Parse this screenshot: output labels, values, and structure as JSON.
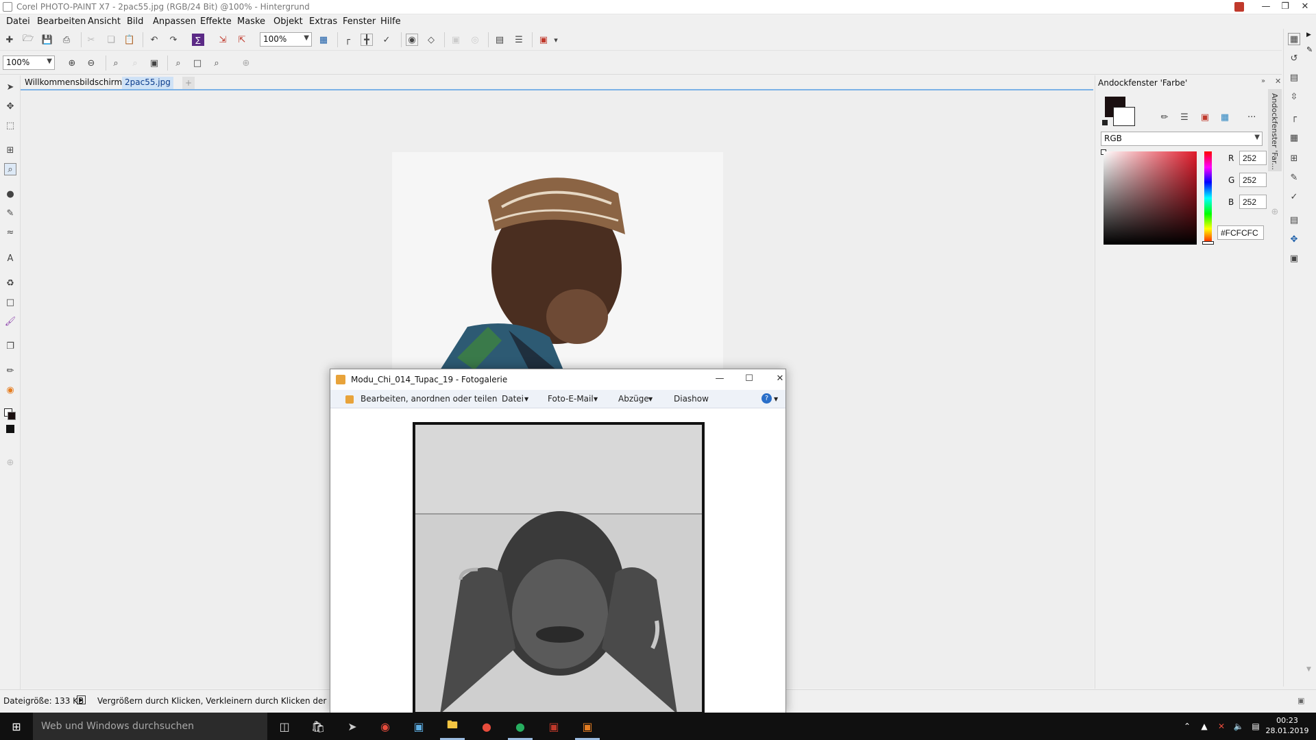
{
  "window": {
    "title": "Corel PHOTO-PAINT X7 - 2pac55.jpg (RGB/24 Bit) @100% - Hintergrund",
    "minimize_icon": "minimize-icon",
    "maximize_icon": "restore-icon",
    "close_icon": "close-icon"
  },
  "menu": [
    "Datei",
    "Bearbeiten",
    "Ansicht",
    "Bild",
    "Anpassen",
    "Effekte",
    "Maske",
    "Objekt",
    "Extras",
    "Fenster",
    "Hilfe"
  ],
  "toolbar": {
    "zoom_value": "100%"
  },
  "toolbar2": {
    "zoom_value": "100%"
  },
  "tabs": {
    "welcome": "Willkommensbildschirm",
    "document": "2pac55.jpg"
  },
  "docker": {
    "title": "Andockfenster 'Farbe'",
    "vertical_tab": "Andockfenster 'Far...",
    "model": "RGB",
    "r_label": "R",
    "g_label": "G",
    "b_label": "B",
    "r_value": "252",
    "g_value": "252",
    "b_value": "252",
    "hex_value": "#FCFCFC",
    "more": "..."
  },
  "statusbar": {
    "filesize": "Dateigröße: 133 KB",
    "hint": "Vergrößern durch Klicken, Verkleinern durch Klicken der rechten"
  },
  "gallery": {
    "title": "Modu_Chi_014_Tupac_19 - Fotogalerie",
    "menu_edit": "Bearbeiten, anordnen oder teilen",
    "menu_file": "Datei",
    "menu_email": "Foto-E-Mail",
    "menu_prints": "Abzüge",
    "menu_slideshow": "Diashow"
  },
  "taskbar": {
    "search_placeholder": "Web und Windows durchsuchen",
    "time": "00:23",
    "date": "28.01.2019"
  },
  "colors": {
    "accent": "#7bb1e6",
    "active_tab_bg": "#cfe2f6",
    "taskbar": "#101010",
    "primary_color": "#1a0f10",
    "secondary_color": "#ffffff"
  }
}
